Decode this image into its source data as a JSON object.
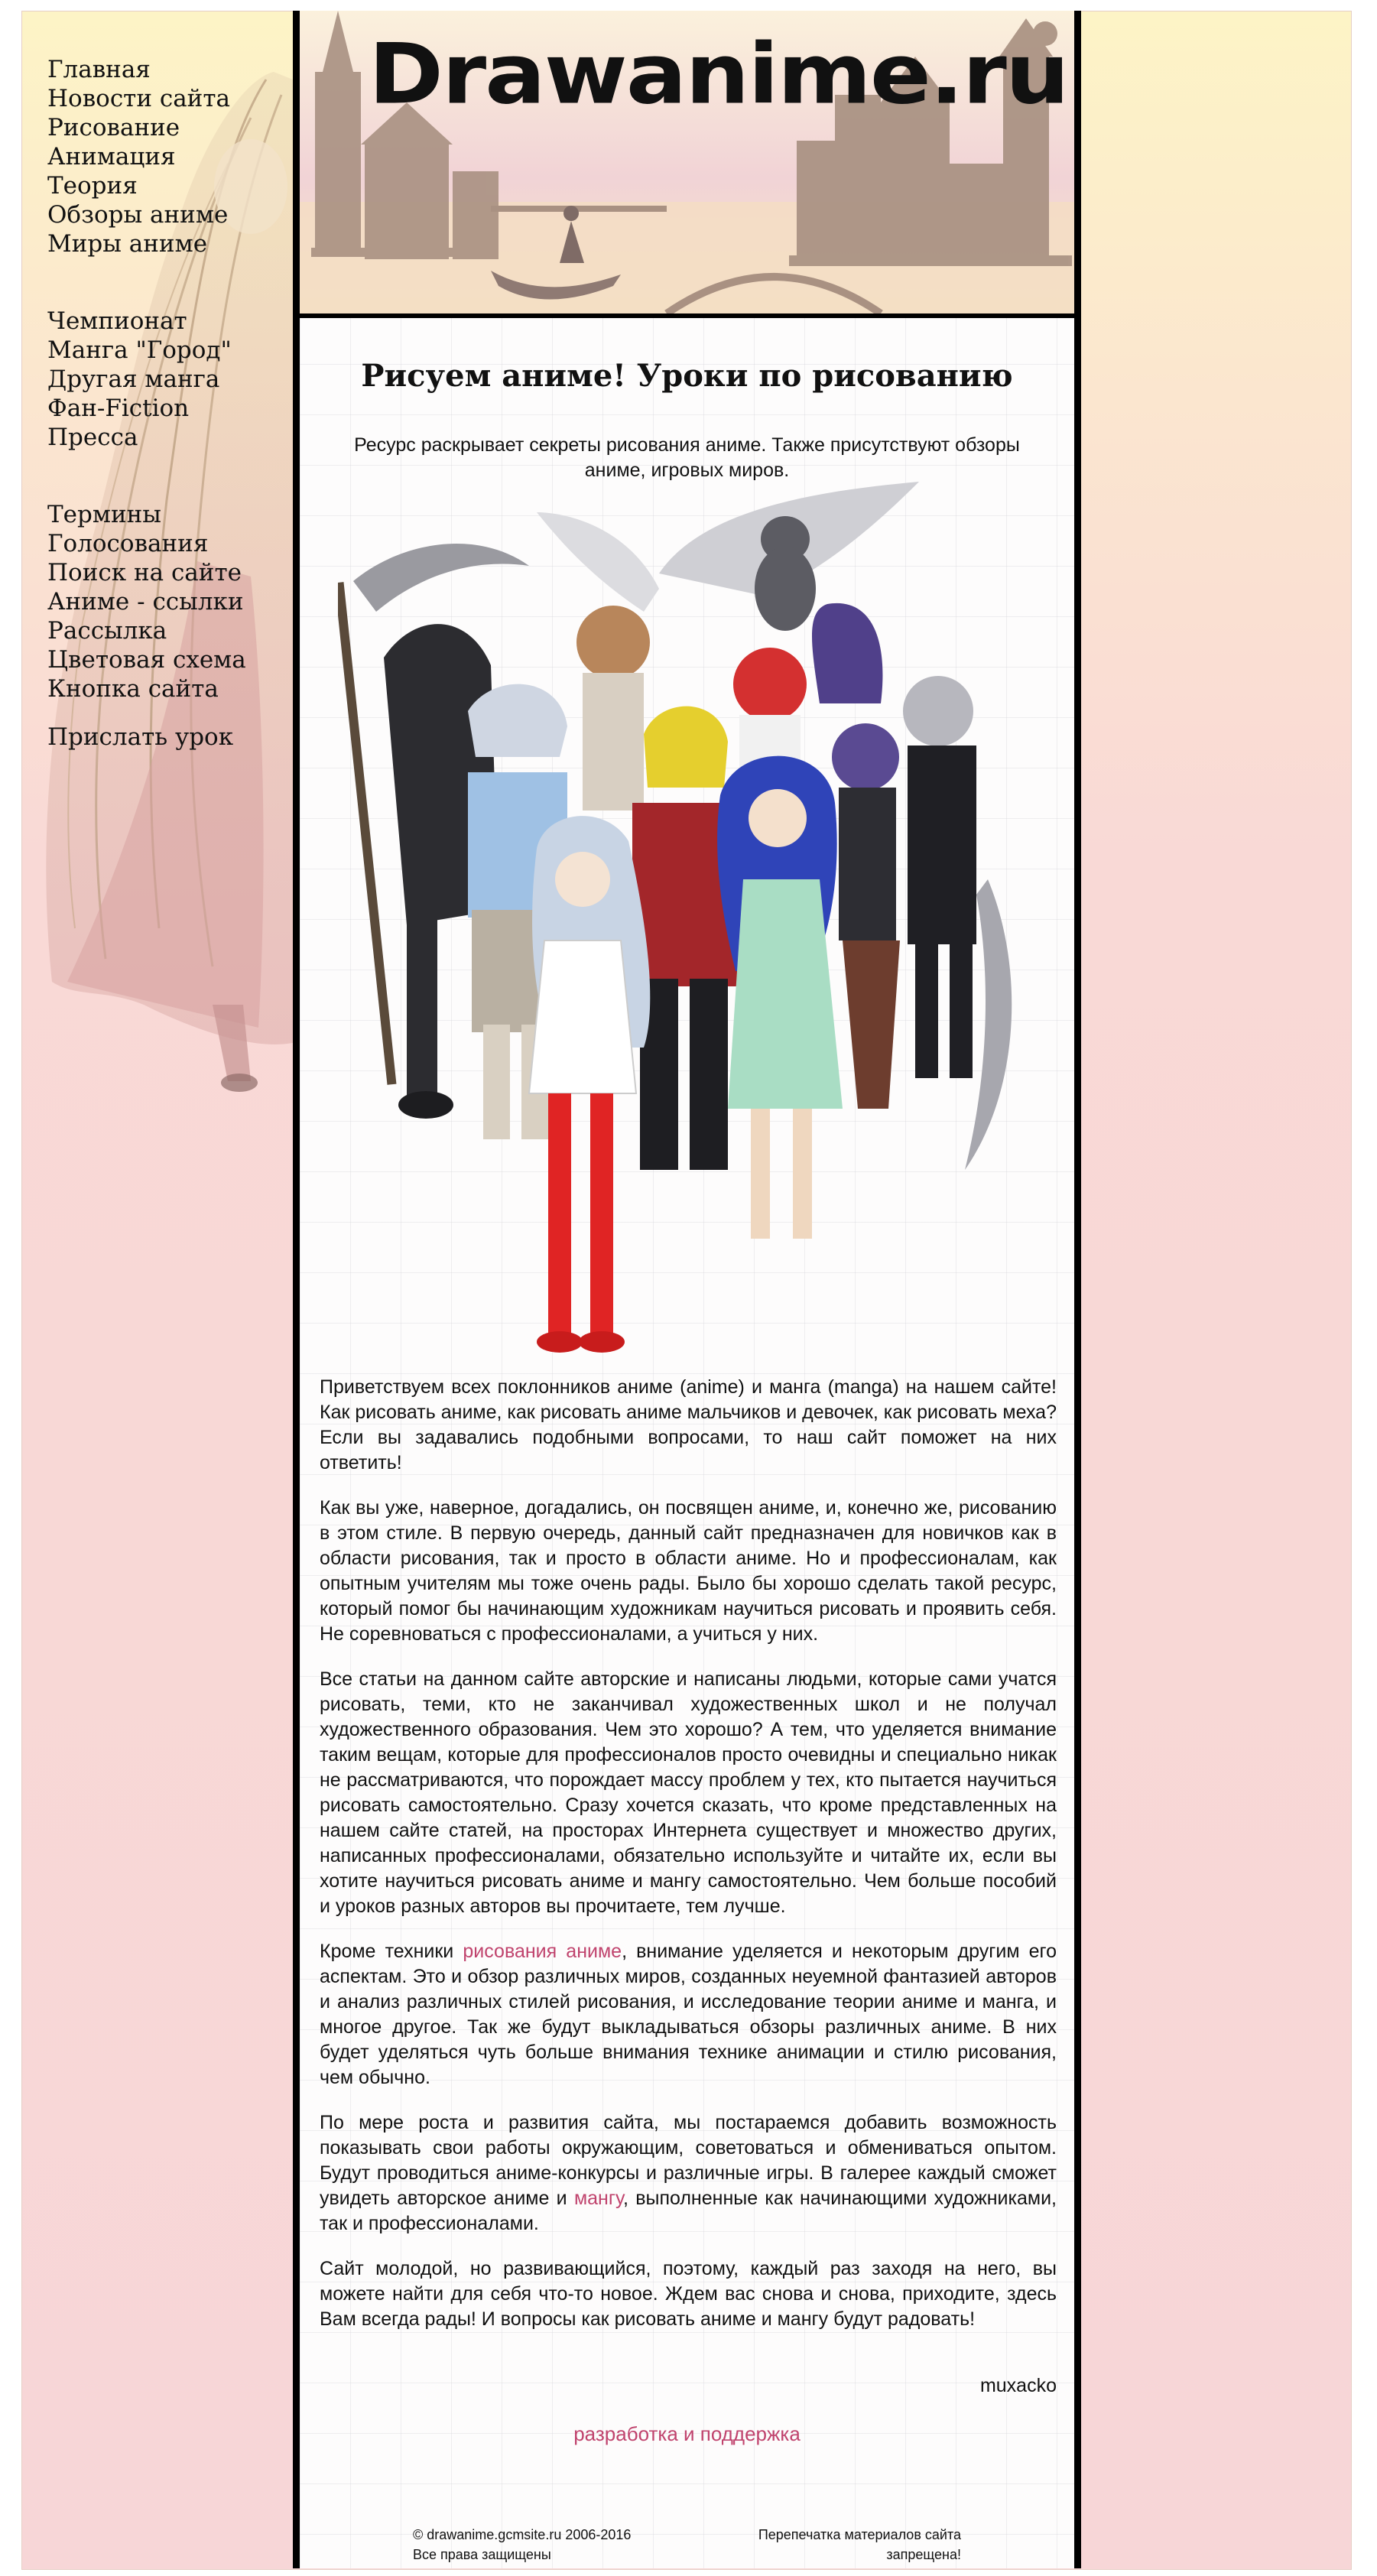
{
  "site": {
    "logo_text": "Drawanime.ru"
  },
  "sidebar": {
    "group1": [
      "Главная",
      "Новости сайта",
      "Рисование",
      "Анимация",
      "Теория",
      "Обзоры аниме",
      "Миры аниме"
    ],
    "group2": [
      "Чемпионат",
      "Манга \"Город\"",
      "Другая манга",
      "Фан-Fiction",
      "Пресса"
    ],
    "group3": [
      "Термины",
      "Голосования",
      "Поиск на сайте",
      "Аниме - ссылки",
      "Рассылка",
      "Цветовая схема",
      "Кнопка сайта"
    ],
    "group4": [
      "Прислать урок"
    ]
  },
  "main": {
    "title": "Рисуем аниме! Уроки по рисованию",
    "intro": "Ресурс раскрывает секреты рисования аниме. Также присутствуют обзоры аниме, игровых миров.",
    "p1": "Приветствуем всех поклонников аниме (anime) и манга (manga) на нашем сайте! Как рисовать аниме, как рисовать аниме мальчиков и девочек, как рисовать меха? Если вы задавались подобными вопросами, то наш сайт поможет на них ответить!",
    "p2": "Как вы уже, наверное, догадались, он посвящен аниме, и, конечно же, рисованию в этом стиле. В первую очередь, данный сайт предназначен для новичков как в области рисования, так и просто в области аниме. Но и профессионалам, как опытным учителям мы тоже очень рады. Было бы хорошо сделать такой ресурс, который помог бы начинающим художникам научиться рисовать и проявить себя. Не соревноваться с профессионалами, а учиться у них.",
    "p3": "Все статьи на данном сайте авторские и написаны людьми, которые сами учатся рисовать, теми, кто не заканчивал художественных школ и не получал художественного образования. Чем это хорошо? А тем, что уделяется внимание таким вещам, которые для профессионалов просто очевидны и специально никак не рассматриваются, что порождает массу проблем у тех, кто пытается научиться рисовать самостоятельно. Сразу хочется сказать, что кроме представленных на нашем сайте статей, на просторах Интернета существует и множество других, написанных профессионалами, обязательно используйте и читайте их, если вы хотите научиться рисовать аниме и мангу самостоятельно. Чем больше пособий и уроков разных авторов вы прочитаете, тем лучше.",
    "p4_before": "Кроме техники ",
    "p4_link": "рисования аниме",
    "p4_after": ", внимание уделяется и некоторым другим его аспектам. Это и обзор различных миров, созданных неуемной фантазией авторов и анализ различных стилей рисования, и исследование теории аниме и манга, и многое другое. Так же будут выкладываться обзоры различных аниме. В них будет уделяться чуть больше внимания технике анимации и стилю рисования, чем обычно.",
    "p5_before": "По мере роста и развития сайта, мы постараемся добавить возможность показывать свои работы окружающим, советоваться и обмениваться опытом. Будут проводиться аниме-конкурсы и различные игры. В галерее каждый сможет увидеть авторское аниме и ",
    "p5_link": "мангу",
    "p5_after": ", выполненные как начинающими художниками, так и профессионалами.",
    "p6": "Сайт молодой, но развивающийся, поэтому, каждый раз заходя на него, вы можете найти для себя что-то новое. Ждем вас снова и снова, приходите, здесь Вам всегда рады! И вопросы как рисовать аниме и мангу будут радовать!",
    "signature": "muxacko",
    "dev_link": "разработка и поддержка"
  },
  "footer": {
    "copyright_line1": "© drawanime.gcmsite.ru 2006-2016",
    "copyright_line2": "Все права защищены",
    "reprint_line1": "Перепечатка материалов сайта",
    "reprint_line2": "запрещена!"
  },
  "colors": {
    "link": "#c0436d",
    "border": "#000000",
    "background_top": "#fdf4c6",
    "background_bottom": "#f7d6d7"
  },
  "icons": {
    "sidebar_art": "anime-girl-illustration",
    "header_art": "castle-town-silhouette",
    "hero_art": "anime-characters-group-illustration"
  }
}
